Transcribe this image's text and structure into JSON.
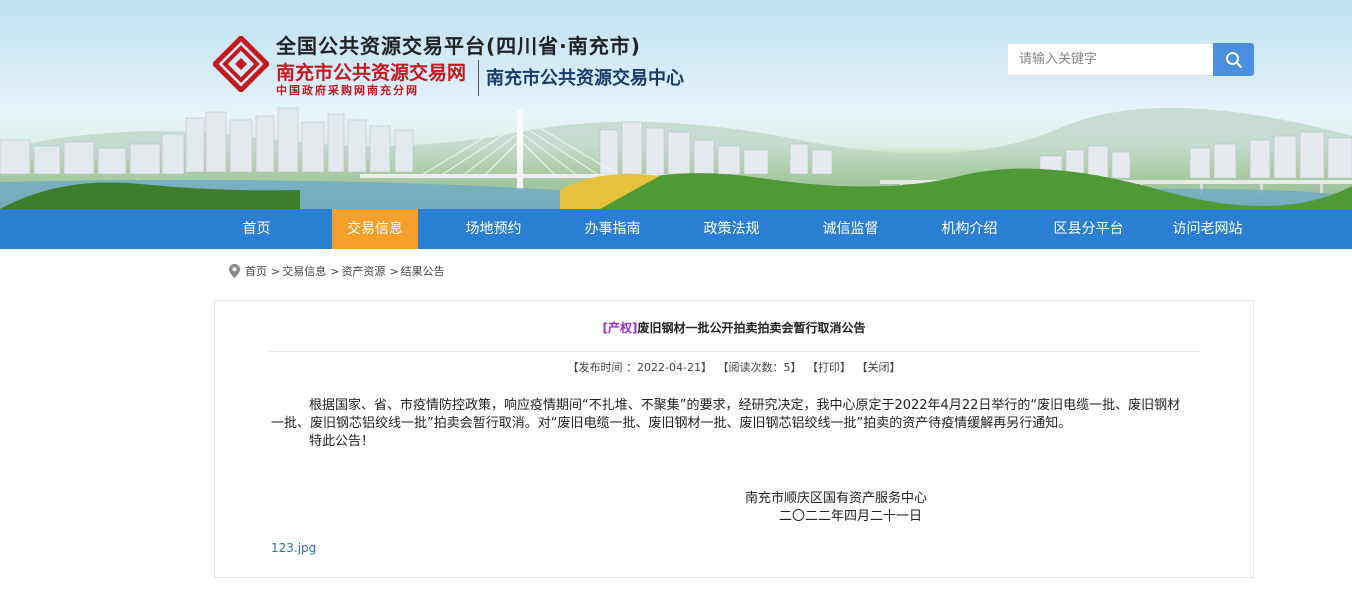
{
  "header": {
    "platform_title": "全国公共资源交易平台(四川省·南充市)",
    "site_name": "南充市公共资源交易网",
    "site_subtitle": "中国政府采购网南充分网",
    "center_name": "南充市公共资源交易中心",
    "logo_icon": "nanchong-logo-icon"
  },
  "search": {
    "placeholder": "请输入关键字",
    "button_icon": "search-icon"
  },
  "nav": {
    "items": [
      "首页",
      "交易信息",
      "场地预约",
      "办事指南",
      "政策法规",
      "诚信监督",
      "机构介绍",
      "区县分平台",
      "访问老网站"
    ],
    "active": "交易信息"
  },
  "breadcrumb": {
    "icon": "location-pin-icon",
    "items": [
      "首页",
      "交易信息",
      "资产资源",
      "结果公告"
    ],
    "separator": ">"
  },
  "article": {
    "tag": "[产权]",
    "title": "废旧钢材一批公开拍卖拍卖会暂行取消公告",
    "meta": {
      "publish_time": "【发布时间 ：2022-04-21】",
      "views": "【阅读次数：5】",
      "print": "【打印】",
      "close": "【关闭】"
    },
    "paragraphs": [
      "根据国家、省、市疫情防控政策，响应疫情期间“不扎堆、不聚集”的要求，经研究决定，我中心原定于2022年4月22日举行的“废旧电缆一批、废旧钢材一批、废旧钢芯铝绞线一批”拍卖会暂行取消。对“废旧电缆一批、废旧钢材一批、废旧钢芯铝绞线一批”拍卖的资产待疫情缓解再另行通知。",
      "特此公告！"
    ],
    "signature_org": "南充市顺庆区国有资产服务中心",
    "signature_date": "二〇二二年四月二十一日",
    "attachment": "123.jpg"
  },
  "colors": {
    "nav_bg": "#2b7fd2",
    "nav_active": "#f5a02a",
    "brand_red": "#c4191f",
    "tag_purple": "#9b30d9",
    "link_blue": "#2a6fb8",
    "search_button": "#4a8fe0"
  }
}
